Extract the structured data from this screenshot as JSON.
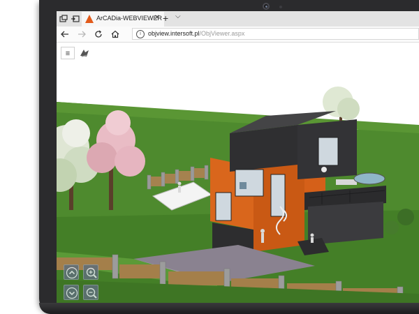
{
  "browser": {
    "tab": {
      "title": "ArCADia-WEBVIEWER",
      "close_glyph": "✕"
    },
    "new_tab_glyph": "+",
    "tab_list_glyph": "⌵",
    "address": {
      "host": "objview.intersoft.pl",
      "path": "/ObjViewer.aspx"
    }
  },
  "icons": {
    "tab_actions": "tab-actions-icon",
    "tabs_aside": "tabs-aside-icon",
    "back": "back-arrow-icon",
    "forward": "forward-arrow-icon",
    "refresh": "refresh-icon",
    "home": "home-icon",
    "info": "info-icon",
    "menu": "hamburger-menu-icon",
    "logo": "arcadia-logo-icon",
    "pan_up": "chevron-up-icon",
    "pan_down": "chevron-down-icon",
    "zoom_in": "zoom-in-icon",
    "zoom_out": "zoom-out-icon"
  },
  "viewer": {
    "menu_glyph": "≡"
  },
  "colors": {
    "facade_orange": "#d9661c",
    "roof_dark": "#3a3a3c",
    "grass": "#4e8a2e",
    "sky": "#ffffff",
    "control_bg": "#5e6e7a"
  }
}
